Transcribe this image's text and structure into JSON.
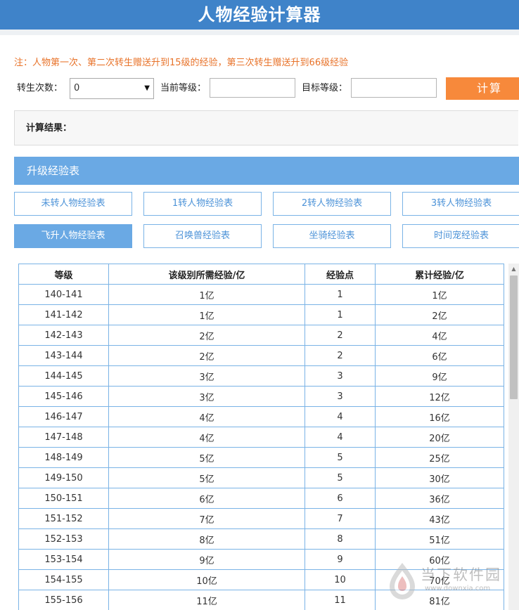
{
  "header": {
    "title": "人物经验计算器"
  },
  "notice": "注：人物第一次、第二次转生赠送升到15级的经验，第三次转生赠送升到66级经验",
  "form": {
    "rebirth_label": "转生次数：",
    "rebirth_value": "0",
    "current_level_label": "当前等级：",
    "current_level_value": "",
    "target_level_label": "目标等级：",
    "target_level_value": "",
    "calc_button": "计算"
  },
  "result": {
    "label": "计算结果："
  },
  "section": {
    "title": "升级经验表"
  },
  "tabs": [
    {
      "label": "未转人物经验表",
      "active": false
    },
    {
      "label": "1转人物经验表",
      "active": false
    },
    {
      "label": "2转人物经验表",
      "active": false
    },
    {
      "label": "3转人物经验表",
      "active": false
    },
    {
      "label": "飞升人物经验表",
      "active": true
    },
    {
      "label": "召唤兽经验表",
      "active": false
    },
    {
      "label": "坐骑经验表",
      "active": false
    },
    {
      "label": "时间宠经验表",
      "active": false
    }
  ],
  "table": {
    "columns": [
      "等级",
      "该级别所需经验/亿",
      "经验点",
      "累计经验/亿"
    ],
    "rows": [
      [
        "140-141",
        "1亿",
        "1",
        "1亿"
      ],
      [
        "141-142",
        "1亿",
        "1",
        "2亿"
      ],
      [
        "142-143",
        "2亿",
        "2",
        "4亿"
      ],
      [
        "143-144",
        "2亿",
        "2",
        "6亿"
      ],
      [
        "144-145",
        "3亿",
        "3",
        "9亿"
      ],
      [
        "145-146",
        "3亿",
        "3",
        "12亿"
      ],
      [
        "146-147",
        "4亿",
        "4",
        "16亿"
      ],
      [
        "147-148",
        "4亿",
        "4",
        "20亿"
      ],
      [
        "148-149",
        "5亿",
        "5",
        "25亿"
      ],
      [
        "149-150",
        "5亿",
        "5",
        "30亿"
      ],
      [
        "150-151",
        "6亿",
        "6",
        "36亿"
      ],
      [
        "151-152",
        "7亿",
        "7",
        "43亿"
      ],
      [
        "152-153",
        "8亿",
        "8",
        "51亿"
      ],
      [
        "153-154",
        "9亿",
        "9",
        "60亿"
      ],
      [
        "154-155",
        "10亿",
        "10",
        "70亿"
      ],
      [
        "155-156",
        "11亿",
        "11",
        "81亿"
      ]
    ]
  },
  "watermark": {
    "name": "当下软件园",
    "url": "www.downxia.com"
  },
  "colors": {
    "header": "#3f83c9",
    "accent": "#6aa9e4",
    "button": "#f7893b",
    "notice": "#e8732a",
    "border": "#7ab3e6"
  }
}
